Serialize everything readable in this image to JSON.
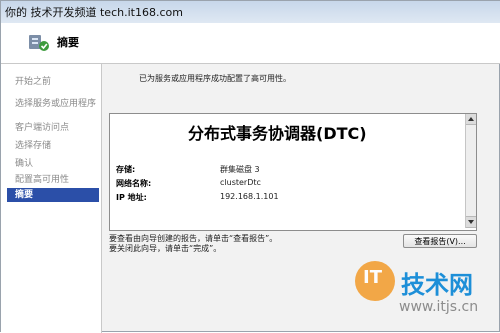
{
  "site_title": "你的 技术开发频道 tech.it168.com",
  "header": {
    "title": "摘要",
    "icon": "cluster-wizard-icon"
  },
  "nav": {
    "items": [
      {
        "label": "开始之前"
      },
      {
        "label": "选择服务或应用程序"
      },
      {
        "label": "客户端访问点"
      },
      {
        "label": "选择存储"
      },
      {
        "label": "确认"
      },
      {
        "label": "配置高可用性"
      },
      {
        "label": "摘要",
        "active": true
      }
    ]
  },
  "main": {
    "message": "已为服务或应用程序成功配置了高可用性。",
    "report": {
      "title": "分布式事务协调器(DTC)",
      "rows": [
        {
          "label": "存储:",
          "value": "群集磁盘 3"
        },
        {
          "label": "网络名称:",
          "value": "clusterDtc"
        },
        {
          "label": "IP 地址:",
          "value": "192.168.1.101"
        }
      ]
    },
    "hint_line1": "要查看由向导创建的报告，请单击“查看报告”。",
    "hint_line2": "要关闭此向导，请单击“完成”。",
    "view_report_button": "查看报告(V)..."
  },
  "watermark": {
    "brand_char": "IT",
    "text": "技术网",
    "url": "www.itjs.cn"
  }
}
